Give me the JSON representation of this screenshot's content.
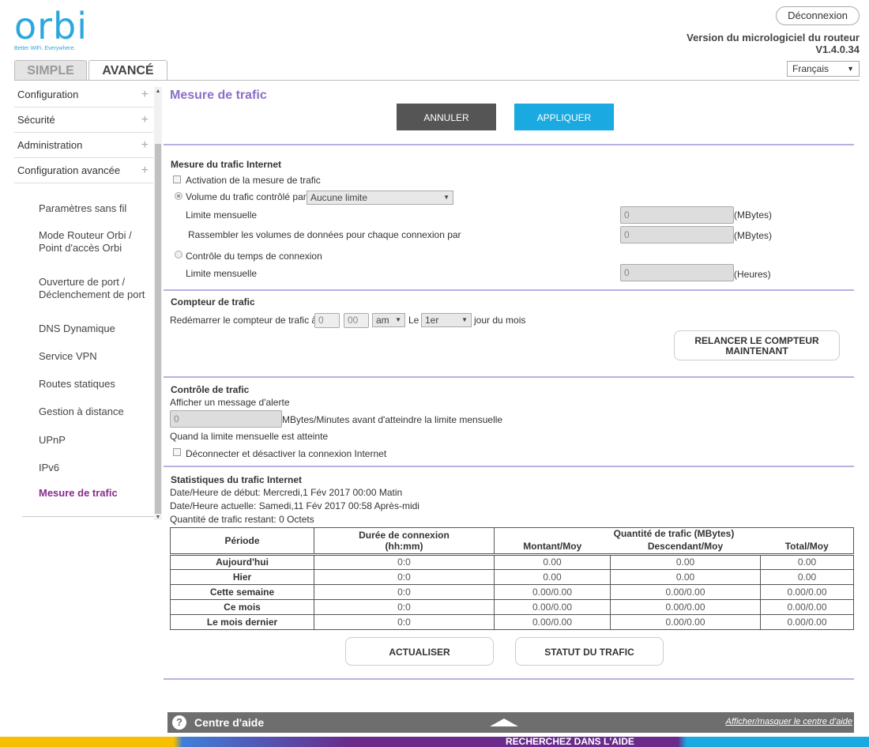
{
  "header": {
    "brand": "orbi",
    "tagline": "Better WiFi. Everywhere.",
    "tabs": [
      "SIMPLE",
      "AVANCÉ"
    ],
    "logout_label": "Déconnexion",
    "firmware_label": "Version du micrologiciel du routeur",
    "firmware_version": "V1.4.0.34",
    "language": "Français"
  },
  "sidebar": {
    "main": [
      "Configuration",
      "Sécurité",
      "Administration",
      "Configuration avancée"
    ],
    "sub": [
      "Paramètres sans fil",
      "Mode Routeur Orbi / Point d'accès Orbi",
      "Ouverture de port / Déclenchement de port",
      "DNS Dynamique",
      "Service VPN",
      "Routes statiques",
      "Gestion à distance",
      "UPnP",
      "IPv6",
      "Mesure de trafic"
    ]
  },
  "page": {
    "title": "Mesure de trafic",
    "cancel_label": "ANNULER",
    "apply_label": "APPLIQUER"
  },
  "internet_meter": {
    "title": "Mesure du trafic Internet",
    "enable_label": "Activation de la mesure de trafic",
    "volume_label": "Volume du trafic contrôlé par",
    "volume_select": "Aucune limite",
    "monthly_limit_label": "Limite mensuelle",
    "monthly_limit_value": "0",
    "monthly_limit_unit": "(MBytes)",
    "combine_label": "Rassembler les volumes de données pour chaque connexion par",
    "combine_value": "0",
    "combine_unit": "(MBytes)",
    "time_label": "Contrôle du temps de connexion",
    "time_limit_label": "Limite mensuelle",
    "time_limit_value": "0",
    "time_limit_unit": "(Heures)"
  },
  "counter": {
    "title": "Compteur de trafic",
    "restart_label": "Redémarrer le compteur de trafic à",
    "hour": "0",
    "minute": "00",
    "ampm": "am",
    "day_prefix": "Le",
    "day": "1er",
    "day_suffix": "jour du mois",
    "restart_now_line1": "RELANCER LE COMPTEUR",
    "restart_now_line2": "MAINTENANT"
  },
  "control": {
    "title": "Contrôle de trafic",
    "alert_label": "Afficher un message d'alerte",
    "alert_value": "0",
    "alert_unit": "MBytes/Minutes avant d'atteindre la limite mensuelle",
    "reached_label": "Quand la limite mensuelle est atteinte",
    "disconnect_label": "Déconnecter et désactiver la connexion Internet"
  },
  "stats": {
    "title": "Statistiques du trafic Internet",
    "start": "Date/Heure de début: Mercredi,1 Fév 2017 00:00 Matin",
    "current": "Date/Heure actuelle: Samedi,11 Fév 2017 00:58 Après-midi",
    "remaining": "Quantité de trafic restant: 0 Octets",
    "headers": {
      "period": "Période",
      "duration_line1": "Durée de connexion",
      "duration_line2": "(hh:mm)",
      "quantity": "Quantité de trafic (MBytes)",
      "up": "Montant/Moy",
      "down": "Descendant/Moy",
      "total": "Total/Moy"
    },
    "rows": [
      {
        "period": "Aujourd'hui",
        "duration": "0:0",
        "up": "0.00",
        "down": "0.00",
        "total": "0.00"
      },
      {
        "period": "Hier",
        "duration": "0:0",
        "up": "0.00",
        "down": "0.00",
        "total": "0.00"
      },
      {
        "period": "Cette semaine",
        "duration": "0:0",
        "up": "0.00/0.00",
        "down": "0.00/0.00",
        "total": "0.00/0.00"
      },
      {
        "period": "Ce mois",
        "duration": "0:0",
        "up": "0.00/0.00",
        "down": "0.00/0.00",
        "total": "0.00/0.00"
      },
      {
        "period": "Le mois dernier",
        "duration": "0:0",
        "up": "0.00/0.00",
        "down": "0.00/0.00",
        "total": "0.00/0.00"
      }
    ],
    "refresh_label": "ACTUALISER",
    "status_label": "STATUT DU TRAFIC"
  },
  "help": {
    "title": "Centre d'aide",
    "toggle": "Afficher/masquer le centre d'aide"
  },
  "banner": {
    "text": "RECHERCHEZ DANS L'AIDE"
  },
  "colors": {
    "accent": "#1aa9e0",
    "title": "#8b6fc6",
    "active_nav": "#8b2a8e",
    "divider": "#b6b2e3"
  }
}
